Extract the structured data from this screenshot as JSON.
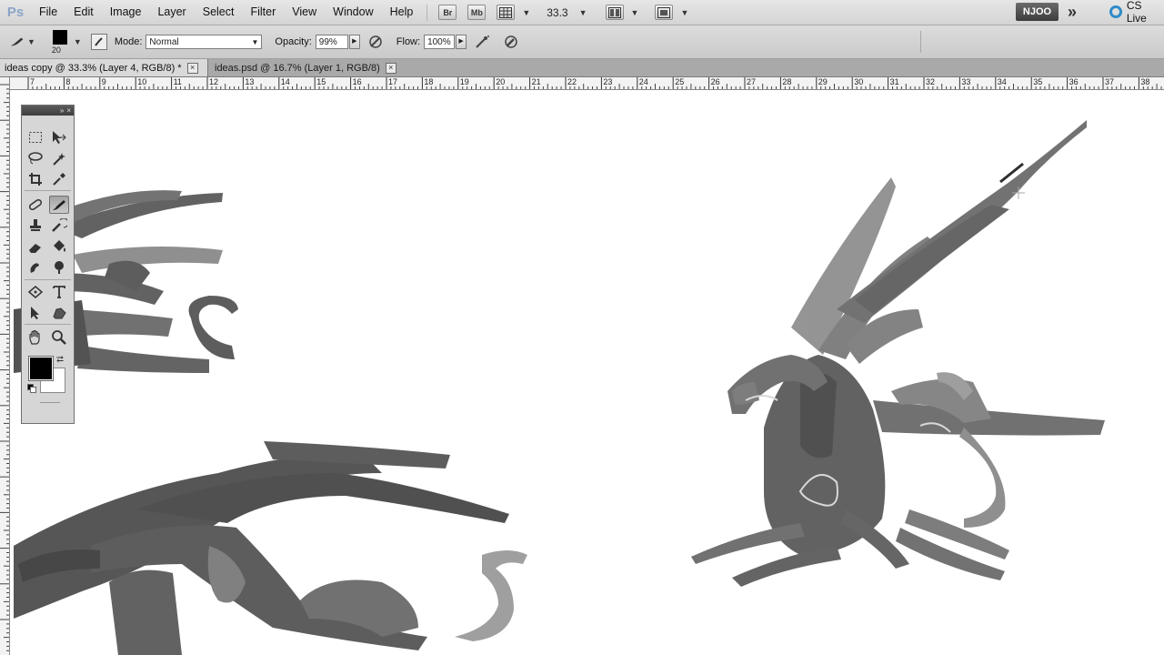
{
  "app": {
    "logo": "Ps"
  },
  "menu": {
    "items": [
      "File",
      "Edit",
      "Image",
      "Layer",
      "Select",
      "Filter",
      "View",
      "Window",
      "Help"
    ],
    "bridge_label": "Br",
    "minibridge_label": "Mb",
    "zoom_value": "33.3",
    "workspace_label": "NJOO",
    "cs_live_label": "CS Live"
  },
  "options": {
    "brush_size": "20",
    "mode_label": "Mode:",
    "mode_value": "Normal",
    "opacity_label": "Opacity:",
    "opacity_value": "99%",
    "flow_label": "Flow:",
    "flow_value": "100%"
  },
  "tabs": [
    {
      "label": "ideas copy @ 33.3% (Layer 4, RGB/8) *",
      "active": true
    },
    {
      "label": "ideas.psd @ 16.7% (Layer 1, RGB/8)",
      "active": false
    }
  ],
  "ruler": {
    "h_labels": [
      "7",
      "8",
      "9",
      "10",
      "11",
      "12",
      "13",
      "14",
      "15",
      "16",
      "17",
      "18",
      "19",
      "20",
      "21",
      "22",
      "23",
      "24",
      "25",
      "26",
      "27",
      "28",
      "29",
      "30",
      "31",
      "32",
      "33",
      "34",
      "35",
      "36",
      "37",
      "38"
    ]
  },
  "tools_panel": {
    "icons": [
      "marquee-icon",
      "move-icon",
      "lasso-icon",
      "magic-wand-icon",
      "crop-icon",
      "eyedropper-icon",
      "healing-brush-icon",
      "brush-icon",
      "clone-stamp-icon",
      "history-brush-icon",
      "eraser-icon",
      "paint-bucket-icon",
      "blur-icon",
      "dodge-icon",
      "pen-icon",
      "type-icon",
      "path-select-icon",
      "shape-icon",
      "hand-icon",
      "zoom-icon"
    ],
    "selected": "brush-icon",
    "foreground_color": "#000000",
    "background_color": "#ffffff"
  },
  "colors": {
    "menubar": "#dcdcdc",
    "canvas": "#ffffff",
    "sketch_dark": "#4a4a4a",
    "sketch_mid": "#7a7a7a",
    "sketch_light": "#9a9a9a",
    "cs_live_accent": "#2f8bc8"
  }
}
